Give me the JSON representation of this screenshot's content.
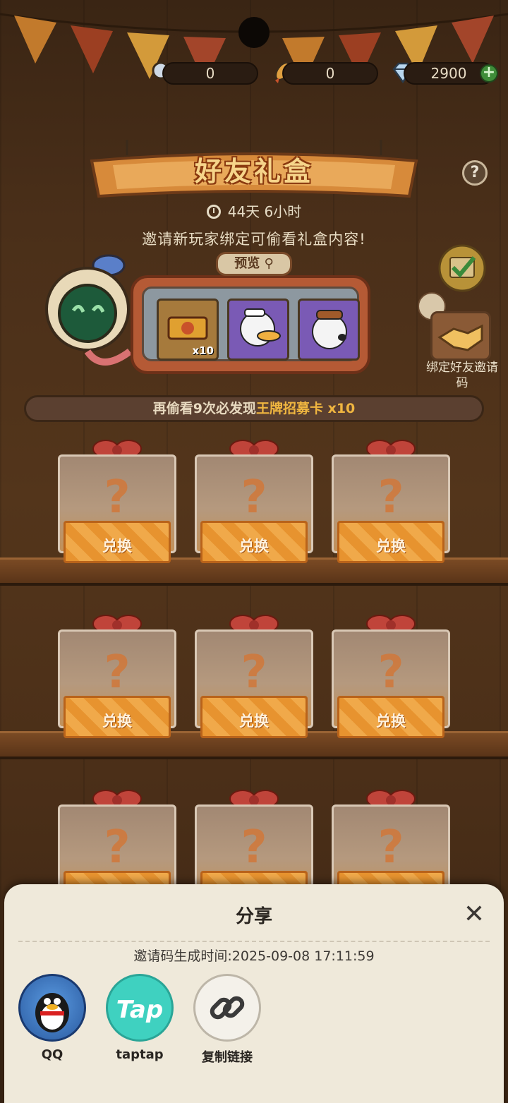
{
  "resources": [
    {
      "icon": "magnifier-icon",
      "value": "0"
    },
    {
      "icon": "rocket-icon",
      "value": "0"
    },
    {
      "icon": "diamond-icon",
      "value": "2900"
    }
  ],
  "header": {
    "title": "好友礼盒",
    "timer": "44天  6小时"
  },
  "invite_text": "邀请新玩家绑定可偷看礼盒内容!",
  "preview": {
    "tab_label": "预览",
    "items": [
      {
        "count": "x10"
      }
    ]
  },
  "bind_label": "绑定好友邀请码",
  "progress": {
    "prefix": "再偷看9次必发现",
    "highlight": "王牌招募卡",
    "suffix": " x10"
  },
  "boxes": [
    {
      "label": "兑换"
    },
    {
      "label": "兑换"
    },
    {
      "label": "兑换"
    },
    {
      "label": "兑换"
    },
    {
      "label": "兑换"
    },
    {
      "label": "兑换"
    },
    {
      "label": ""
    },
    {
      "label": ""
    },
    {
      "label": ""
    }
  ],
  "share": {
    "title": "分享",
    "gen_time": "邀请码生成时间:2025-09-08  17:11:59",
    "buttons": [
      {
        "label": "QQ",
        "icon": "qq-penguin-icon"
      },
      {
        "label": "taptap",
        "icon": "taptap-icon",
        "icon_text": "Tap"
      },
      {
        "label": "复制链接",
        "icon": "link-icon"
      }
    ]
  },
  "colors": {
    "accent_gold": "#f0b640",
    "sheet_bg": "#efe9da",
    "taptap": "#3fd1c0"
  }
}
